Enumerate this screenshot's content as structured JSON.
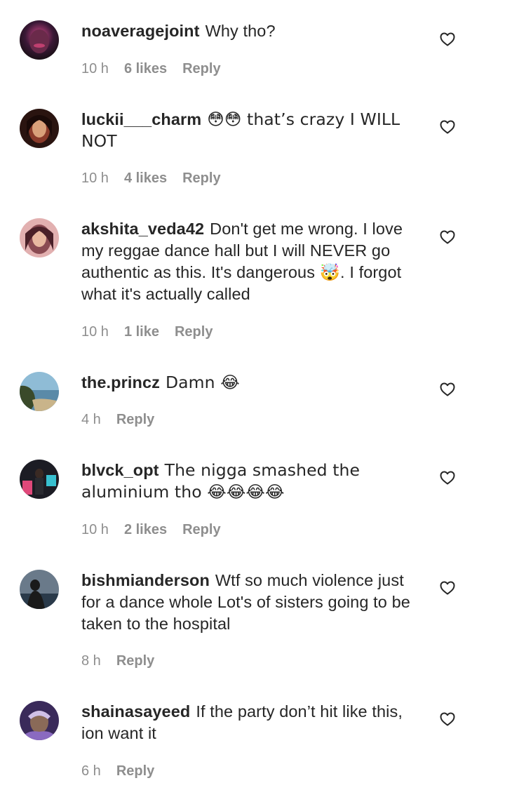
{
  "comments": [
    {
      "username": "noaveragejoint",
      "text": "Why tho?",
      "time": "10 h",
      "likes": "6 likes",
      "reply": "Reply",
      "avatar_colors": [
        "#3a1836",
        "#d84a8a",
        "#1a1016"
      ]
    },
    {
      "username": "luckii___charm",
      "text": "😳😳 that’s crazy I WILL NOT",
      "time": "10 h",
      "likes": "4 likes",
      "reply": "Reply",
      "avatar_colors": [
        "#2a1410",
        "#8a3a2a",
        "#d9a07a"
      ]
    },
    {
      "username": "akshita_veda42",
      "text": "Don't get me wrong. I love my reggae dance hall but I will NEVER go authentic as this. It's dangerous 🤯. I forgot what it's actually called",
      "time": "10 h",
      "likes": "1 like",
      "reply": "Reply",
      "avatar_colors": [
        "#8a4a52",
        "#e2b0b0",
        "#4a2028"
      ]
    },
    {
      "username": "the.princz",
      "text": "Damn 😂",
      "time": "4 h",
      "likes": "",
      "reply": "Reply",
      "avatar_colors": [
        "#8fbcd6",
        "#3a4a2a",
        "#c9b48a"
      ]
    },
    {
      "username": "blvck_opt",
      "text": "The nigga smashed the aluminium tho 😂😂😂😂",
      "time": "10 h",
      "likes": "2 likes",
      "reply": "Reply",
      "avatar_colors": [
        "#1c1c24",
        "#e0487a",
        "#38c0d0"
      ]
    },
    {
      "username": "bishmianderson",
      "text": "Wtf so much violence just for a dance whole Lot's of sisters going to be taken to the hospital",
      "time": "8 h",
      "likes": "",
      "reply": "Reply",
      "avatar_colors": [
        "#2a3a4a",
        "#6a7a8a",
        "#1a1a1a"
      ]
    },
    {
      "username": "shainasayeed",
      "text": "If the party don’t hit like this, ion want it",
      "time": "6 h",
      "likes": "",
      "reply": "Reply",
      "avatar_colors": [
        "#3a2a5a",
        "#8a6ac0",
        "#d0c0e8"
      ]
    }
  ],
  "icons": {
    "heart": "heart-outline-icon"
  },
  "colors": {
    "text": "#262626",
    "meta": "#8e8e8e",
    "background": "#ffffff"
  }
}
